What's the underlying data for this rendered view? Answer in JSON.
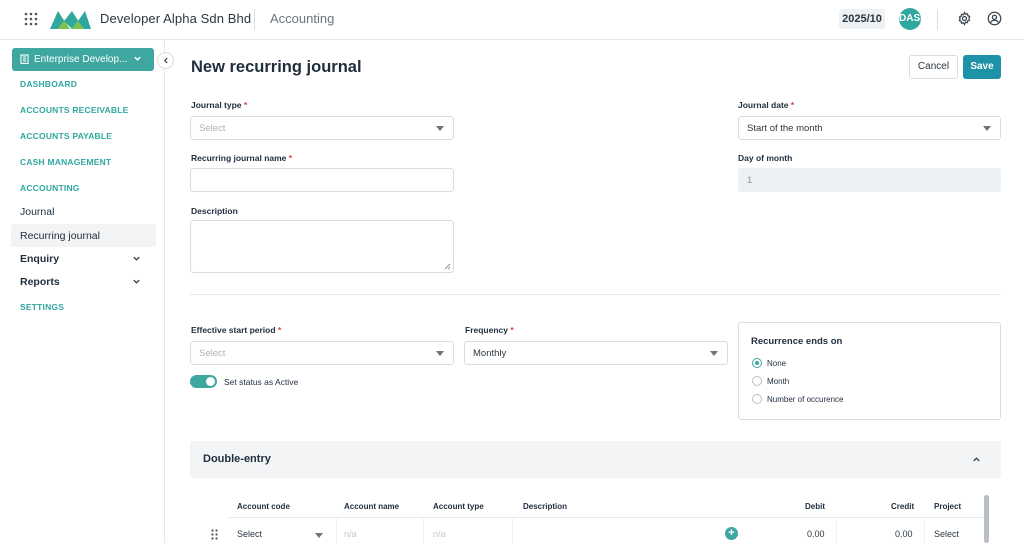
{
  "header": {
    "company_name": "Developer Alpha Sdn Bhd",
    "module_name": "Accounting",
    "period": "2025/10",
    "avatar_initials": "DASB",
    "brand_color": "#3ea8a0"
  },
  "sidebar": {
    "entity_selector": "Enterprise Develop...",
    "items": [
      {
        "label": "DASHBOARD"
      },
      {
        "label": "ACCOUNTS RECEIVABLE"
      },
      {
        "label": "ACCOUNTS PAYABLE"
      },
      {
        "label": "CASH MANAGEMENT"
      },
      {
        "label": "ACCOUNTING"
      }
    ],
    "sub_items": [
      {
        "label": "Journal"
      },
      {
        "label": "Recurring journal",
        "active": true
      },
      {
        "label": "Enquiry"
      },
      {
        "label": "Reports"
      }
    ],
    "settings_label": "SETTINGS"
  },
  "main": {
    "title": "New recurring journal",
    "cancel_label": "Cancel",
    "save_label": "Save",
    "journal_type": {
      "label": "Journal type",
      "placeholder": "Select"
    },
    "journal_date": {
      "label": "Journal date",
      "value": "Start of the month"
    },
    "recurring_name": {
      "label": "Recurring journal name",
      "value": ""
    },
    "day_of_month": {
      "label": "Day of month",
      "value": "1"
    },
    "description": {
      "label": "Description",
      "value": ""
    },
    "effective_start": {
      "label": "Effective start period",
      "placeholder": "Select"
    },
    "frequency": {
      "label": "Frequency",
      "value": "Monthly"
    },
    "status_toggle": {
      "label": "Set status as Active",
      "on": true
    },
    "recurrence": {
      "title": "Recurrence ends on",
      "options": [
        {
          "label": "None",
          "selected": true
        },
        {
          "label": "Month",
          "selected": false
        },
        {
          "label": "Number of occurence",
          "selected": false
        }
      ]
    },
    "double_entry": {
      "title": "Double-entry",
      "columns": [
        "Account code",
        "Account name",
        "Account type",
        "Description",
        "Debit",
        "Credit",
        "Project"
      ],
      "row": {
        "account_code": "Select",
        "account_name": "n/a",
        "account_type": "n/a",
        "debit": "0.00",
        "credit": "0.00",
        "project": "Select"
      }
    }
  }
}
